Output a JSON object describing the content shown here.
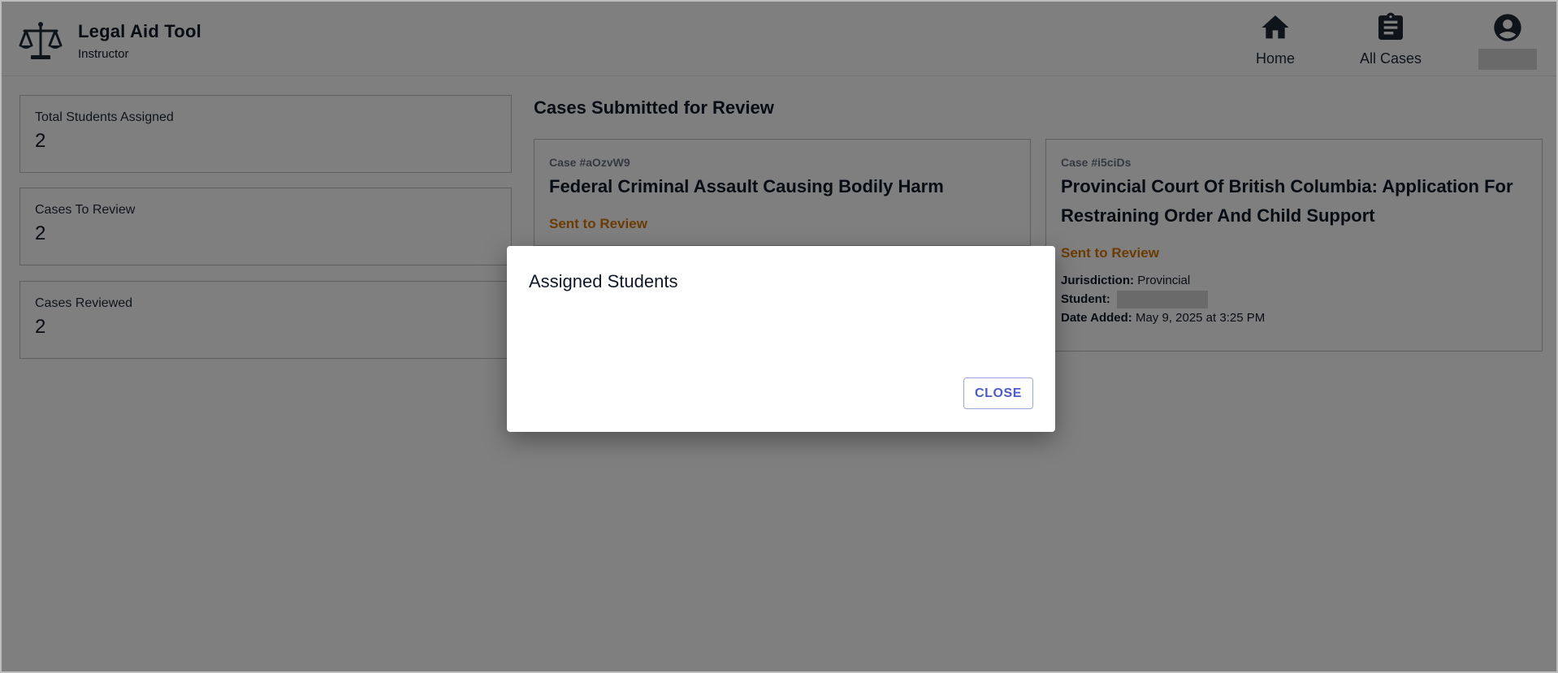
{
  "header": {
    "app_title": "Legal Aid Tool",
    "role": "Instructor",
    "nav": {
      "home": "Home",
      "all_cases": "All Cases"
    }
  },
  "stats": [
    {
      "label": "Total Students Assigned",
      "value": "2"
    },
    {
      "label": "Cases To Review",
      "value": "2"
    },
    {
      "label": "Cases Reviewed",
      "value": "2"
    }
  ],
  "review_section": {
    "title": "Cases Submitted for Review",
    "cases": [
      {
        "id": "Case #aOzvW9",
        "title": "Federal Criminal Assault Causing Bodily Harm",
        "status": "Sent to Review"
      },
      {
        "id": "Case #i5ciDs",
        "title": "Provincial Court Of British Columbia: Application For Restraining Order And Child Support",
        "status": "Sent to Review",
        "jurisdiction_label": "Jurisdiction:",
        "jurisdiction": "Provincial",
        "student_label": "Student:",
        "date_label": "Date Added:",
        "date_added": "May 9, 2025 at 3:25 PM"
      }
    ]
  },
  "modal": {
    "title": "Assigned Students",
    "close_label": "CLOSE"
  },
  "colors": {
    "status": "#d97706",
    "close_button": "#4b5cc4",
    "overlay": "rgba(0,0,0,0.5)"
  }
}
